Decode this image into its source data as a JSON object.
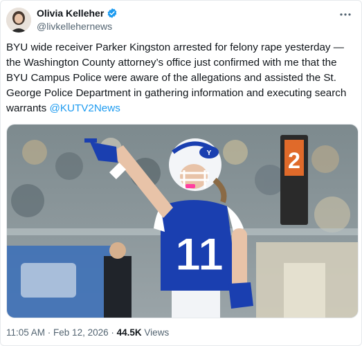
{
  "tweet": {
    "display_name": "Olivia Kelleher",
    "handle": "@livkellehernews",
    "body": "BYU wide receiver Parker Kingston arrested for felony rape yesterday — the Washington County attorney’s office just confirmed with me that the BYU Campus Police were aware of the allegations and assisted the St. George Police Department in gathering information and executing search warrants ",
    "mention": "@KUTV2News",
    "time": "11:05 AM",
    "date": "Feb 12, 2026",
    "views_count": "44.5K",
    "views_label": "Views"
  },
  "media": {
    "jersey_number": "11",
    "sign_number": "2"
  },
  "icons": {
    "verified": "verified-badge-icon",
    "more": "more-options-icon"
  },
  "colors": {
    "accent": "#1d9bf0",
    "byu_blue": "#1a3fb0"
  }
}
